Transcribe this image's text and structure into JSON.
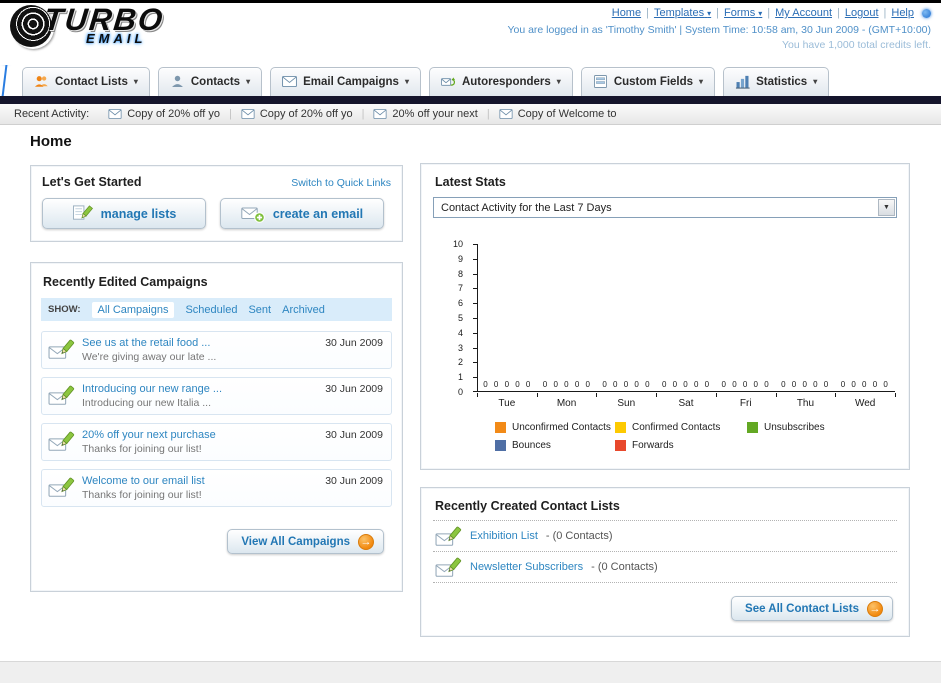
{
  "icons": {
    "chevron_down": "▾",
    "caret_down": "▼",
    "arrow_right": "→"
  },
  "header": {
    "logo_title": "TURBO",
    "logo_subtitle": "EMAIL",
    "link_separator": "|",
    "links": [
      {
        "label": "Home",
        "caret": false
      },
      {
        "label": "Templates",
        "caret": true
      },
      {
        "label": "Forms",
        "caret": true
      },
      {
        "label": "My Account",
        "caret": false
      },
      {
        "label": "Logout",
        "caret": false
      },
      {
        "label": "Help",
        "caret": false
      }
    ],
    "login_info": "You are logged in as 'Timothy Smith' | System Time: 10:58 am, 30 Jun 2009 - (GMT+10:00)",
    "credits_info": "You have 1,000 total credits left."
  },
  "main_nav": {
    "items": [
      {
        "label": "Contact Lists"
      },
      {
        "label": "Contacts"
      },
      {
        "label": "Email Campaigns"
      },
      {
        "label": "Autoresponders"
      },
      {
        "label": "Custom Fields"
      },
      {
        "label": "Statistics"
      }
    ]
  },
  "recent_activity": {
    "label": "Recent Activity:",
    "items": [
      "Copy of 20% off yo",
      "Copy of 20% off yo",
      "20% off your next",
      "Copy of Welcome to"
    ]
  },
  "page": {
    "title": "Home"
  },
  "get_started": {
    "title": "Let's Get Started",
    "switch_link": "Switch to Quick Links",
    "buttons": [
      {
        "label": "manage lists"
      },
      {
        "label": "create an email"
      }
    ]
  },
  "campaigns": {
    "title": "Recently Edited Campaigns",
    "show_label": "SHOW:",
    "tabs": [
      "All Campaigns",
      "Scheduled",
      "Sent",
      "Archived"
    ],
    "items": [
      {
        "title": "See us at the retail food ...",
        "subtitle": "We're giving away our late ...",
        "date": "30 Jun 2009"
      },
      {
        "title": "Introducing our new range ...",
        "subtitle": "Introducing our new Italia ...",
        "date": "30 Jun 2009"
      },
      {
        "title": "20% off your next purchase",
        "subtitle": "Thanks for joining our list!",
        "date": "30 Jun 2009"
      },
      {
        "title": "Welcome to our email list",
        "subtitle": "Thanks for joining our list!",
        "date": "30 Jun 2009"
      }
    ],
    "view_all_label": "View All Campaigns"
  },
  "latest_stats": {
    "title": "Latest Stats",
    "period_selector": "Contact Activity for the Last 7 Days"
  },
  "chart_data": {
    "type": "bar",
    "title": "Contact Activity for the Last 7 Days",
    "categories": [
      "Tue",
      "Mon",
      "Sun",
      "Sat",
      "Fri",
      "Thu",
      "Wed"
    ],
    "series": [
      {
        "name": "Unconfirmed Contacts",
        "color": "#f28a17",
        "values": [
          0,
          0,
          0,
          0,
          0,
          0,
          0
        ]
      },
      {
        "name": "Confirmed Contacts",
        "color": "#fdca01",
        "values": [
          0,
          0,
          0,
          0,
          0,
          0,
          0
        ]
      },
      {
        "name": "Unsubscribes",
        "color": "#63a823",
        "values": [
          0,
          0,
          0,
          0,
          0,
          0,
          0
        ]
      },
      {
        "name": "Bounces",
        "color": "#4f6fa5",
        "values": [
          0,
          0,
          0,
          0,
          0,
          0,
          0
        ]
      },
      {
        "name": "Forwards",
        "color": "#e8482c",
        "values": [
          0,
          0,
          0,
          0,
          0,
          0,
          0
        ]
      }
    ],
    "ylim": [
      0,
      10
    ],
    "yticks": [
      0,
      1,
      2,
      3,
      4,
      5,
      6,
      7,
      8,
      9,
      10
    ],
    "value_labels": true,
    "grid": false,
    "legend_position": "bottom"
  },
  "contact_lists": {
    "title": "Recently Created Contact Lists",
    "items": [
      {
        "name": "Exhibition List",
        "suffix": "- (0 Contacts)"
      },
      {
        "name": "Newsletter Subscribers",
        "suffix": "- (0 Contacts)"
      }
    ],
    "see_all_label": "See All Contact Lists"
  }
}
